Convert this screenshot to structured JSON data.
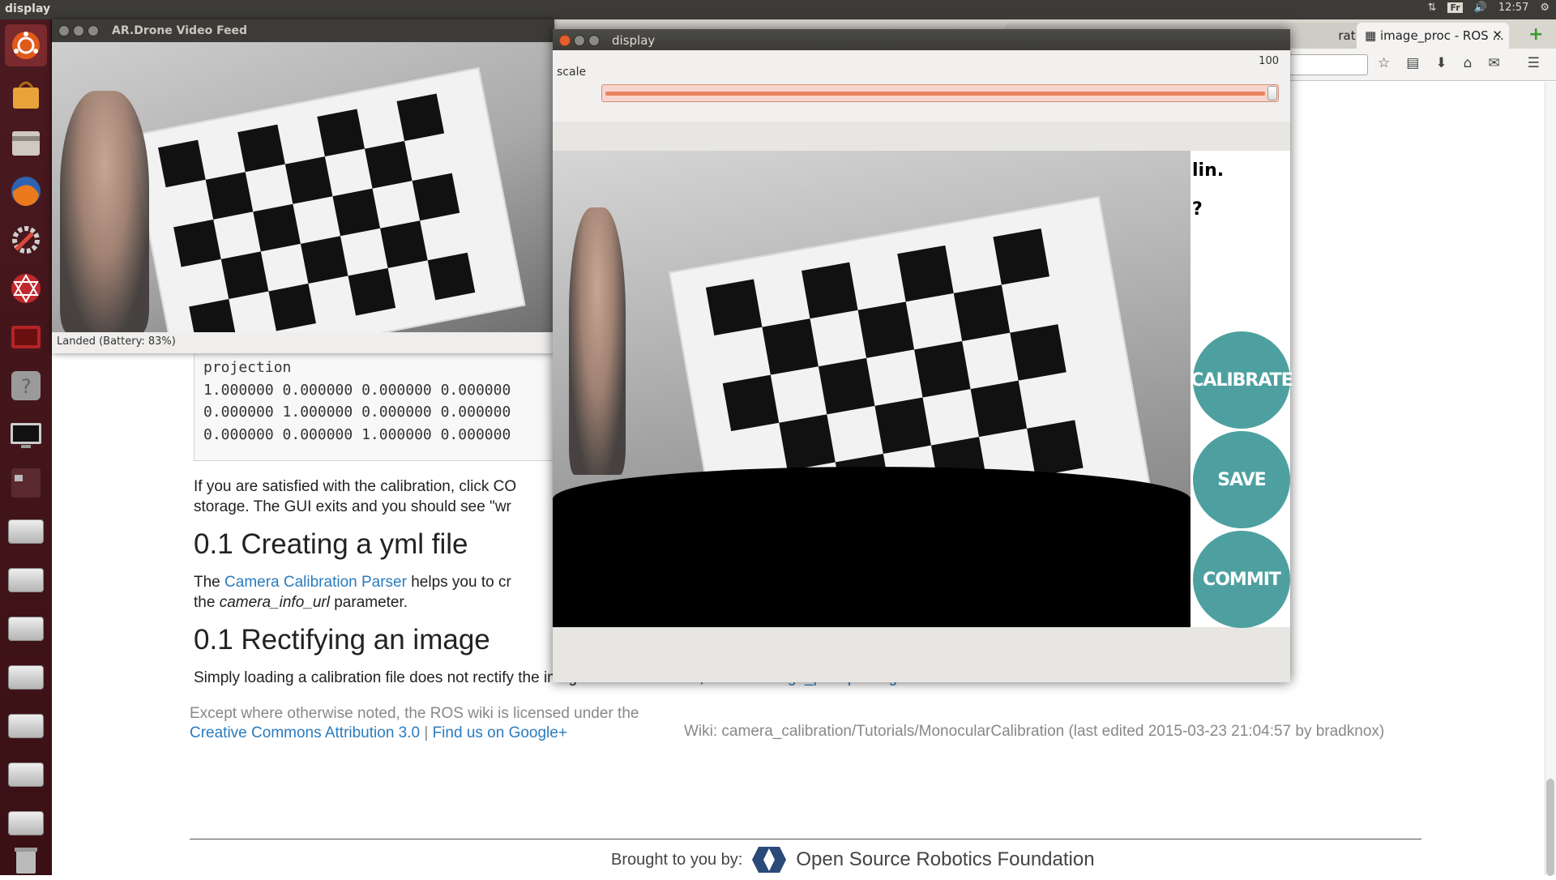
{
  "top_panel": {
    "app_title": "display",
    "keyboard_layout": "Fr",
    "time": "12:57"
  },
  "launcher": {
    "items": [
      "dash-home",
      "software-center",
      "files",
      "firefox",
      "system-settings",
      "rviz",
      "workspace-app",
      "help",
      "display-monitor",
      "workspaces",
      "drive-1",
      "drive-2",
      "drive-3",
      "drive-4",
      "drive-5",
      "drive-6",
      "drive-7",
      "drive-8",
      "trash"
    ]
  },
  "browser": {
    "tabs": [
      {
        "label": "ratio...",
        "active": false
      },
      {
        "label": "image_proc - ROS ...",
        "active": true
      }
    ],
    "new_tab_glyph": "+"
  },
  "page": {
    "code_block": {
      "lines": [
        "projection",
        "1.000000 0.000000 0.000000 0.000000",
        "0.000000 1.000000 0.000000 0.000000",
        "0.000000 0.000000 1.000000 0.000000"
      ]
    },
    "para1_line1": "If you are satisfied with the calibration, click CO",
    "para1_line2": "storage. The GUI exits and you should see \"wr",
    "h_yml": "0.1 Creating a yml file",
    "yml_the": "The",
    "yml_link": "Camera Calibration Parser",
    "yml_rest": "helps you to cr",
    "yml_line2_pre": "the",
    "yml_line2_em": "camera_info_url",
    "yml_line2_post": "parameter.",
    "h_rect": "0.1 Rectifying an image",
    "rect_text": "Simply loading a calibration file does not rectify the image. For rectification, use the",
    "rect_link": "image_proc package",
    "rect_end": ".",
    "footer_license": "Except where otherwise noted, the ROS wiki is licensed under the",
    "footer_cc": "Creative Commons Attribution 3.0",
    "footer_sep": "|",
    "footer_google": "Find us on Google+",
    "footer_wiki": "Wiki: camera_calibration/Tutorials/MonocularCalibration (last edited 2015-03-23 21:04:57 by bradknox)",
    "brought_by": "Brought to you by:",
    "osrf": "Open Source Robotics Foundation"
  },
  "video_window": {
    "title": "AR.Drone Video Feed",
    "status": "Landed (Battery: 83%)"
  },
  "display_window": {
    "title": "display",
    "scale_label": "scale",
    "scale_value": "100",
    "scale_fraction": 1.0,
    "side_text_1": "lin.",
    "side_text_2": "?",
    "buttons": {
      "calibrate": "CALIBRATE",
      "save": "SAVE",
      "commit": "COMMIT"
    },
    "button_color": "#4ea0a0"
  }
}
